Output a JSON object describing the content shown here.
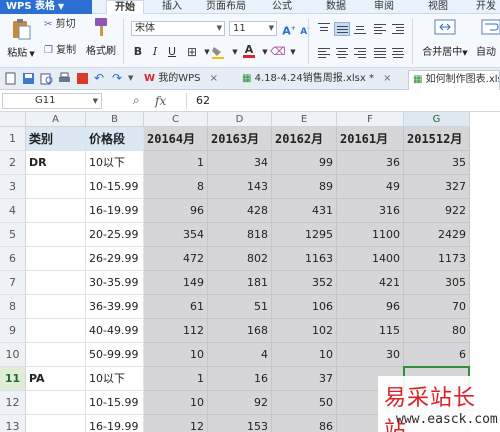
{
  "app": {
    "name": "WPS 表格"
  },
  "menu": {
    "items": [
      "开始",
      "插入",
      "页面布局",
      "公式",
      "数据",
      "审阅",
      "视图",
      "开发"
    ],
    "active": "开始"
  },
  "ribbon": {
    "paste": "粘贴",
    "cut": "剪切",
    "copy": "复制",
    "format_painter": "格式刷",
    "font_name": "宋体",
    "font_size": "11",
    "bold": "B",
    "italic": "I",
    "underline": "U",
    "merge_center": "合并居中",
    "auto_wrap": "自动",
    "font_color": "#d9262c",
    "fill_color": "#f2c200"
  },
  "doc_tabs": [
    {
      "label": "我的WPS",
      "active": false
    },
    {
      "label": "4.18-4.24销售周报.xlsx *",
      "active": false
    },
    {
      "label": "如何制作图表.xlsx",
      "active": true
    }
  ],
  "formula_bar": {
    "cell_ref": "G11",
    "fx": "fx",
    "value": "62"
  },
  "columns": [
    "A",
    "B",
    "C",
    "D",
    "E",
    "F",
    "G"
  ],
  "selected_column": "G",
  "selected_row": "11",
  "row_numbers": [
    "1",
    "2",
    "3",
    "4",
    "5",
    "6",
    "7",
    "8",
    "9",
    "10",
    "11",
    "12",
    "13"
  ],
  "rows": [
    [
      "类别",
      "价格段",
      "20164月",
      "20163月",
      "20162月",
      "20161月",
      "201512月"
    ],
    [
      "DR",
      "10以下",
      "1",
      "34",
      "99",
      "36",
      "35"
    ],
    [
      "",
      "10-15.99",
      "8",
      "143",
      "89",
      "49",
      "327"
    ],
    [
      "",
      "16-19.99",
      "96",
      "428",
      "431",
      "316",
      "922"
    ],
    [
      "",
      "20-25.99",
      "354",
      "818",
      "1295",
      "1100",
      "2429"
    ],
    [
      "",
      "26-29.99",
      "472",
      "802",
      "1163",
      "1400",
      "1173"
    ],
    [
      "",
      "30-35.99",
      "149",
      "181",
      "352",
      "421",
      "305"
    ],
    [
      "",
      "36-39.99",
      "61",
      "51",
      "106",
      "96",
      "70"
    ],
    [
      "",
      "40-49.99",
      "112",
      "168",
      "102",
      "115",
      "80"
    ],
    [
      "",
      "50-99.99",
      "10",
      "4",
      "10",
      "30",
      "6"
    ],
    [
      "PA",
      "10以下",
      "1",
      "16",
      "37",
      "",
      ""
    ],
    [
      "",
      "10-15.99",
      "10",
      "92",
      "50",
      "",
      ""
    ],
    [
      "",
      "16-19.99",
      "12",
      "153",
      "86",
      "",
      ""
    ]
  ],
  "watermark": {
    "title": "易采站长站",
    "url": "www.easck.com"
  },
  "colors": {
    "accent": "#2a6fd1",
    "selection": "#2f8f3a",
    "shade": "#d6d6d9"
  }
}
